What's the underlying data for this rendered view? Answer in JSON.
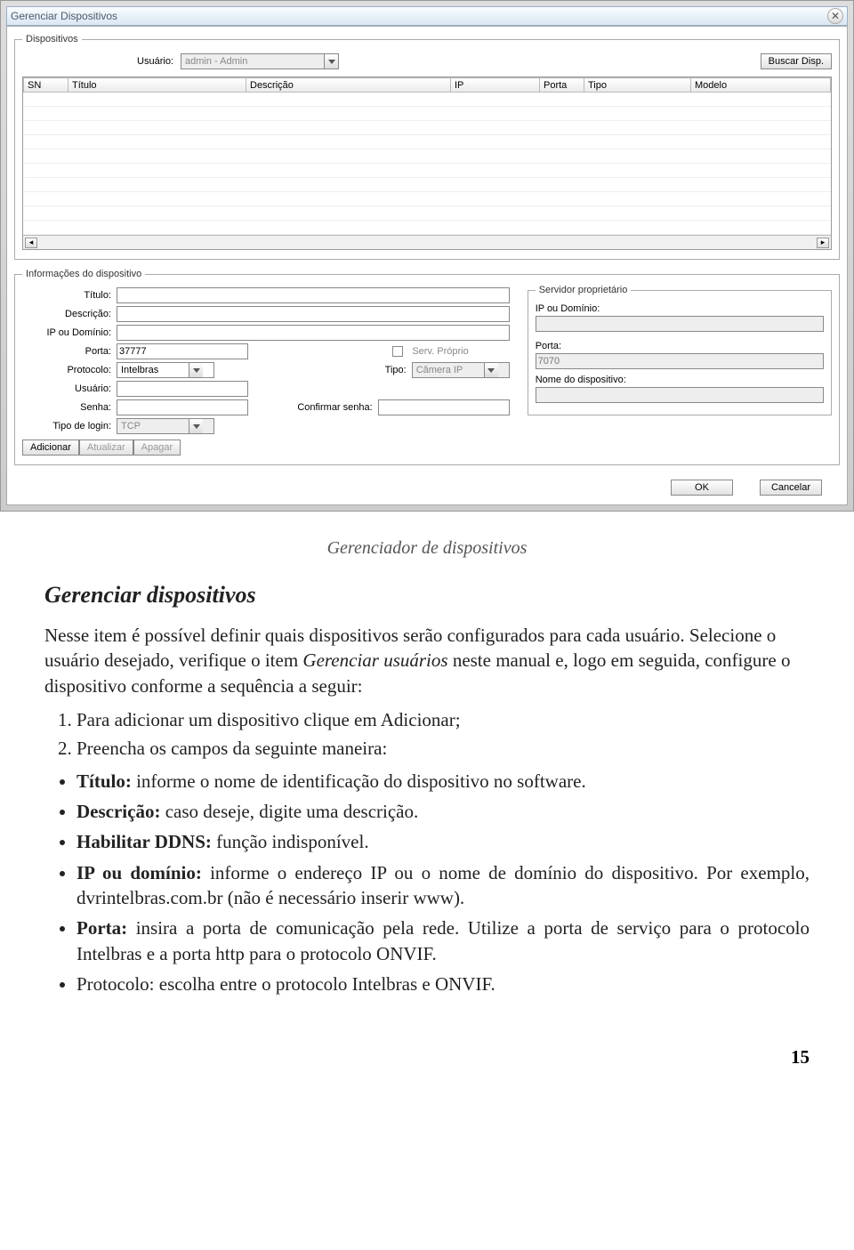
{
  "window": {
    "title": "Gerenciar Dispositivos",
    "fs_devices_legend": "Dispositivos",
    "user_label": "Usuário:",
    "user_value": "admin - Admin",
    "search_btn": "Buscar Disp.",
    "columns": [
      "SN",
      "Título",
      "Descrição",
      "IP",
      "Porta",
      "Tipo",
      "Modelo"
    ],
    "fs_info_legend": "Informações do dispositivo",
    "labels": {
      "titulo": "Título:",
      "descricao": "Descrição:",
      "ip_dominio": "IP ou Domínio:",
      "porta": "Porta:",
      "protocolo": "Protocolo:",
      "usuario": "Usuário:",
      "senha": "Senha:",
      "tipo_login": "Tipo de login:",
      "serv_proprio": "Serv. Próprio",
      "tipo": "Tipo:",
      "confirmar_senha": "Confirmar senha:"
    },
    "values": {
      "porta": "37777",
      "protocolo": "Intelbras",
      "tipo_login": "TCP",
      "tipo": "Câmera IP"
    },
    "server_fs": {
      "legend": "Servidor proprietário",
      "ip_label": "IP ou Domínio:",
      "porta_label": "Porta:",
      "porta_value": "7070",
      "nome_label": "Nome do dispositivo:"
    },
    "btns": {
      "add": "Adicionar",
      "update": "Atualizar",
      "delete": "Apagar",
      "ok": "OK",
      "cancel": "Cancelar"
    }
  },
  "doc": {
    "caption": "Gerenciador de dispositivos",
    "heading": "Gerenciar dispositivos",
    "intro": "Nesse item é possível definir quais dispositivos serão configurados para cada usuário. Selecione o usuário desejado, verifique o item ",
    "intro_it": "Gerenciar usuários",
    "intro2": " neste manual e, logo em seguida, configure o dispositivo conforme a sequência a seguir:",
    "step1a": "Para adicionar um dispositivo clique em ",
    "step1it": "Adicionar",
    "step1b": ";",
    "step2": "Preencha os campos da seguinte maneira:",
    "bul_titulo_b": "Título:",
    "bul_titulo_t": " informe o nome de identificação do dispositivo no software.",
    "bul_desc_b": "Descrição:",
    "bul_desc_t": " caso deseje, digite uma descrição.",
    "bul_ddns_b": "Habilitar DDNS:",
    "bul_ddns_t": " função indisponível.",
    "bul_ip_b": "IP ou domínio:",
    "bul_ip_t1": " informe o endereço IP ou o nome de domínio do dispositivo. Por exemplo, ",
    "bul_ip_it": "dvrintelbras.com.br",
    "bul_ip_t2": " (não é necessário inserir www).",
    "bul_porta_b": "Porta:",
    "bul_porta_t": " insira a porta de comunicação pela rede. Utilize a porta de serviço para o protocolo Intelbras e a porta http para o protocolo ONVIF.",
    "bul_proto": "Protocolo: escolha entre o protocolo Intelbras e ONVIF.",
    "page": "15"
  }
}
